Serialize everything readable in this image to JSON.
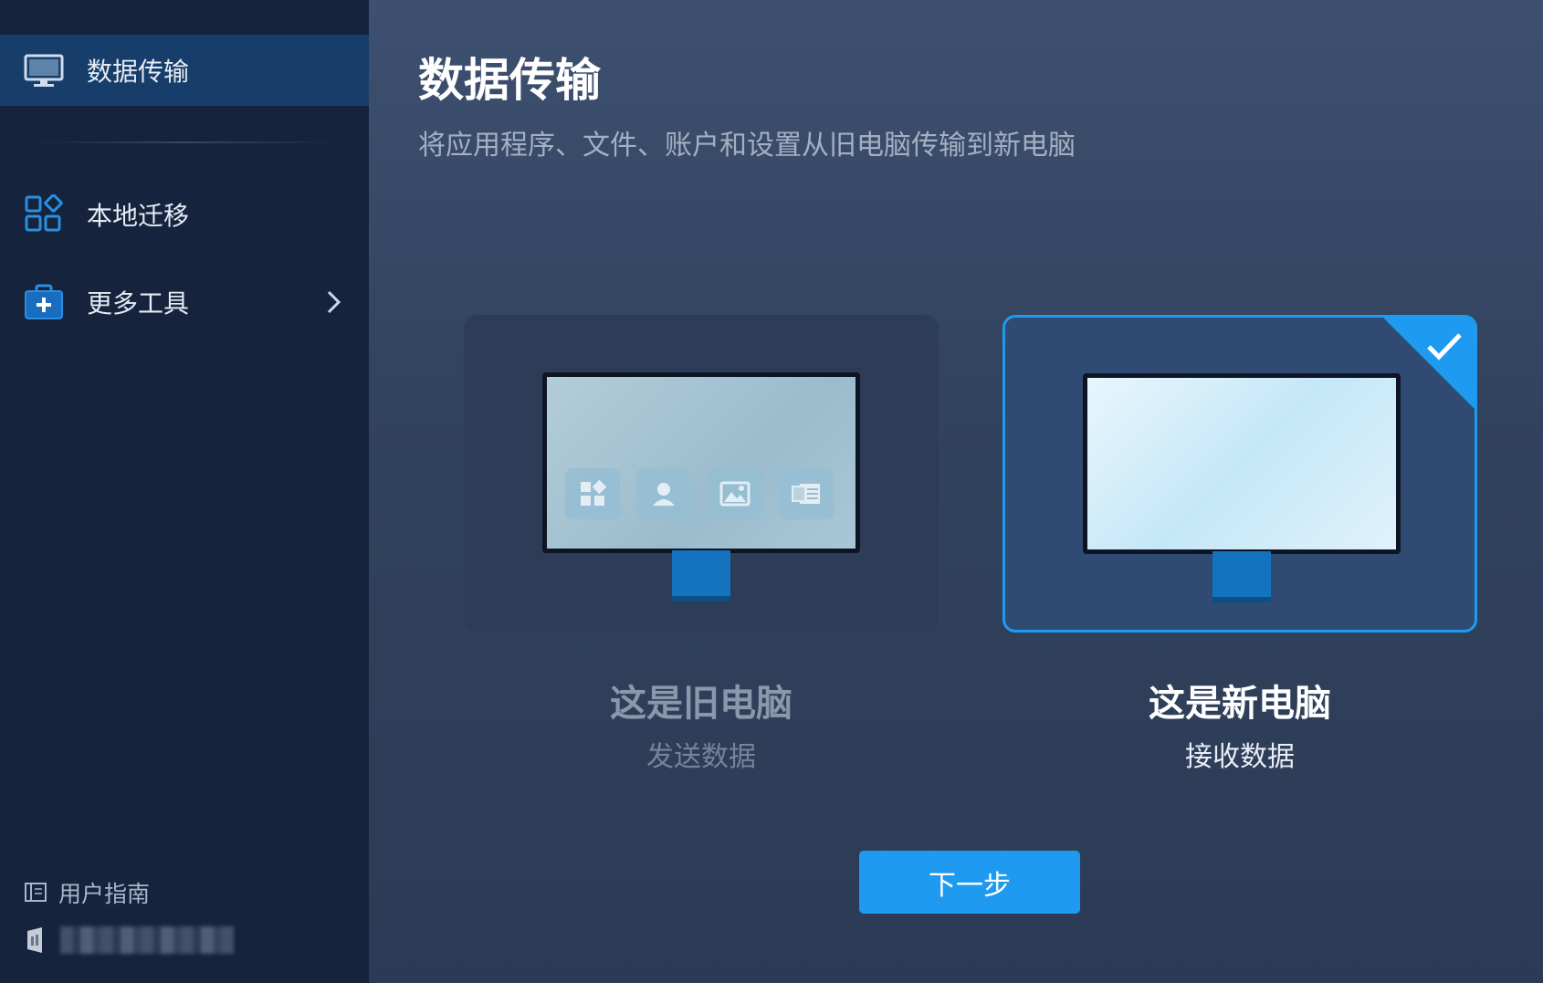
{
  "colors": {
    "accent": "#1e9bf0",
    "sidebar_bg": "#15233d",
    "active_bg": "#173e6a"
  },
  "sidebar": {
    "items": [
      {
        "label": "数据传输",
        "icon": "monitor-icon",
        "active": true
      },
      {
        "label": "本地迁移",
        "icon": "apps-grid-icon",
        "active": false
      },
      {
        "label": "更多工具",
        "icon": "toolbox-icon",
        "active": false
      }
    ],
    "guide_label": "用户指南"
  },
  "main": {
    "title": "数据传输",
    "subtitle": "将应用程序、文件、账户和设置从旧电脑传输到新电脑",
    "options": [
      {
        "title": "这是旧电脑",
        "subtitle": "发送数据",
        "selected": false
      },
      {
        "title": "这是新电脑",
        "subtitle": "接收数据",
        "selected": true
      }
    ],
    "next_label": "下一步"
  }
}
